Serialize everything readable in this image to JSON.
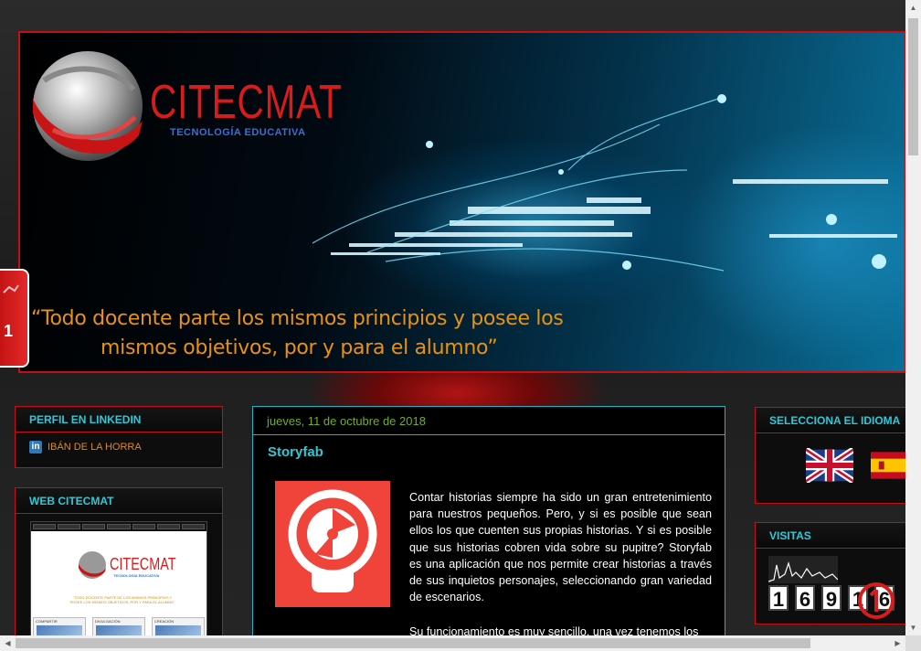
{
  "header": {
    "brand_name": "CITECMAT",
    "brand_tagline": "TECNOLOGÍA EDUCATIVA",
    "quote_line1": "“Todo docente parte los mismos principios y posee los",
    "quote_line2": "mismos objetivos, por y para el alumno”"
  },
  "floating_tab": {
    "count": "1"
  },
  "sidebar_left": {
    "linkedin": {
      "title": "PERFIL EN LINKEDIN",
      "link_text": "IBÁN DE LA HORRA"
    },
    "web": {
      "title": "WEB CITECMAT",
      "thumb_brand": "CITECMAT",
      "thumb_tag": "TECNOLOGÍA EDUCATIVA",
      "thumb_quote": "\"TODO DOCENTE PARTE DE LOS MISMOS PRINCIPIOS Y POSEE LOS MISMOS OBJETIVOS, POR Y PARA EL ALUMNO\"",
      "thumb_cards": [
        "COMPARTIR",
        "DIVULGACIÓN",
        "CREACIÓN"
      ]
    }
  },
  "post": {
    "date": "jueves, 11 de octubre de 2018",
    "title": "Storyfab",
    "paragraph1": "Contar historias siempre ha sido un gran entretenimiento para nuestros pequeños. Pero, y si es posible que sean ellos los que cuenten sus propias historias. Y si es posible que sus historias cobren vida sobre su pupitre? Storyfab es una aplicación que nos permite crear historias a través de sus inquietos personajes, seleccionando gran variedad de escenarios.",
    "paragraph2": "Su funcionamiento es muy sencillo, una vez tenemos los"
  },
  "sidebar_right": {
    "language": {
      "title": "SELECCIONA EL IDIOMA",
      "flags": [
        "uk-flag-icon",
        "spain-flag-icon"
      ]
    },
    "visits": {
      "title": "VISITAS",
      "digits": [
        "1",
        "6",
        "9",
        "1",
        "6"
      ]
    }
  },
  "colors": {
    "accent_red": "#c41010",
    "title_cyan": "#2fc8d8",
    "link_orange": "#e08a1c",
    "date_green": "#6fae2a",
    "quote_orange": "#e8920f"
  }
}
